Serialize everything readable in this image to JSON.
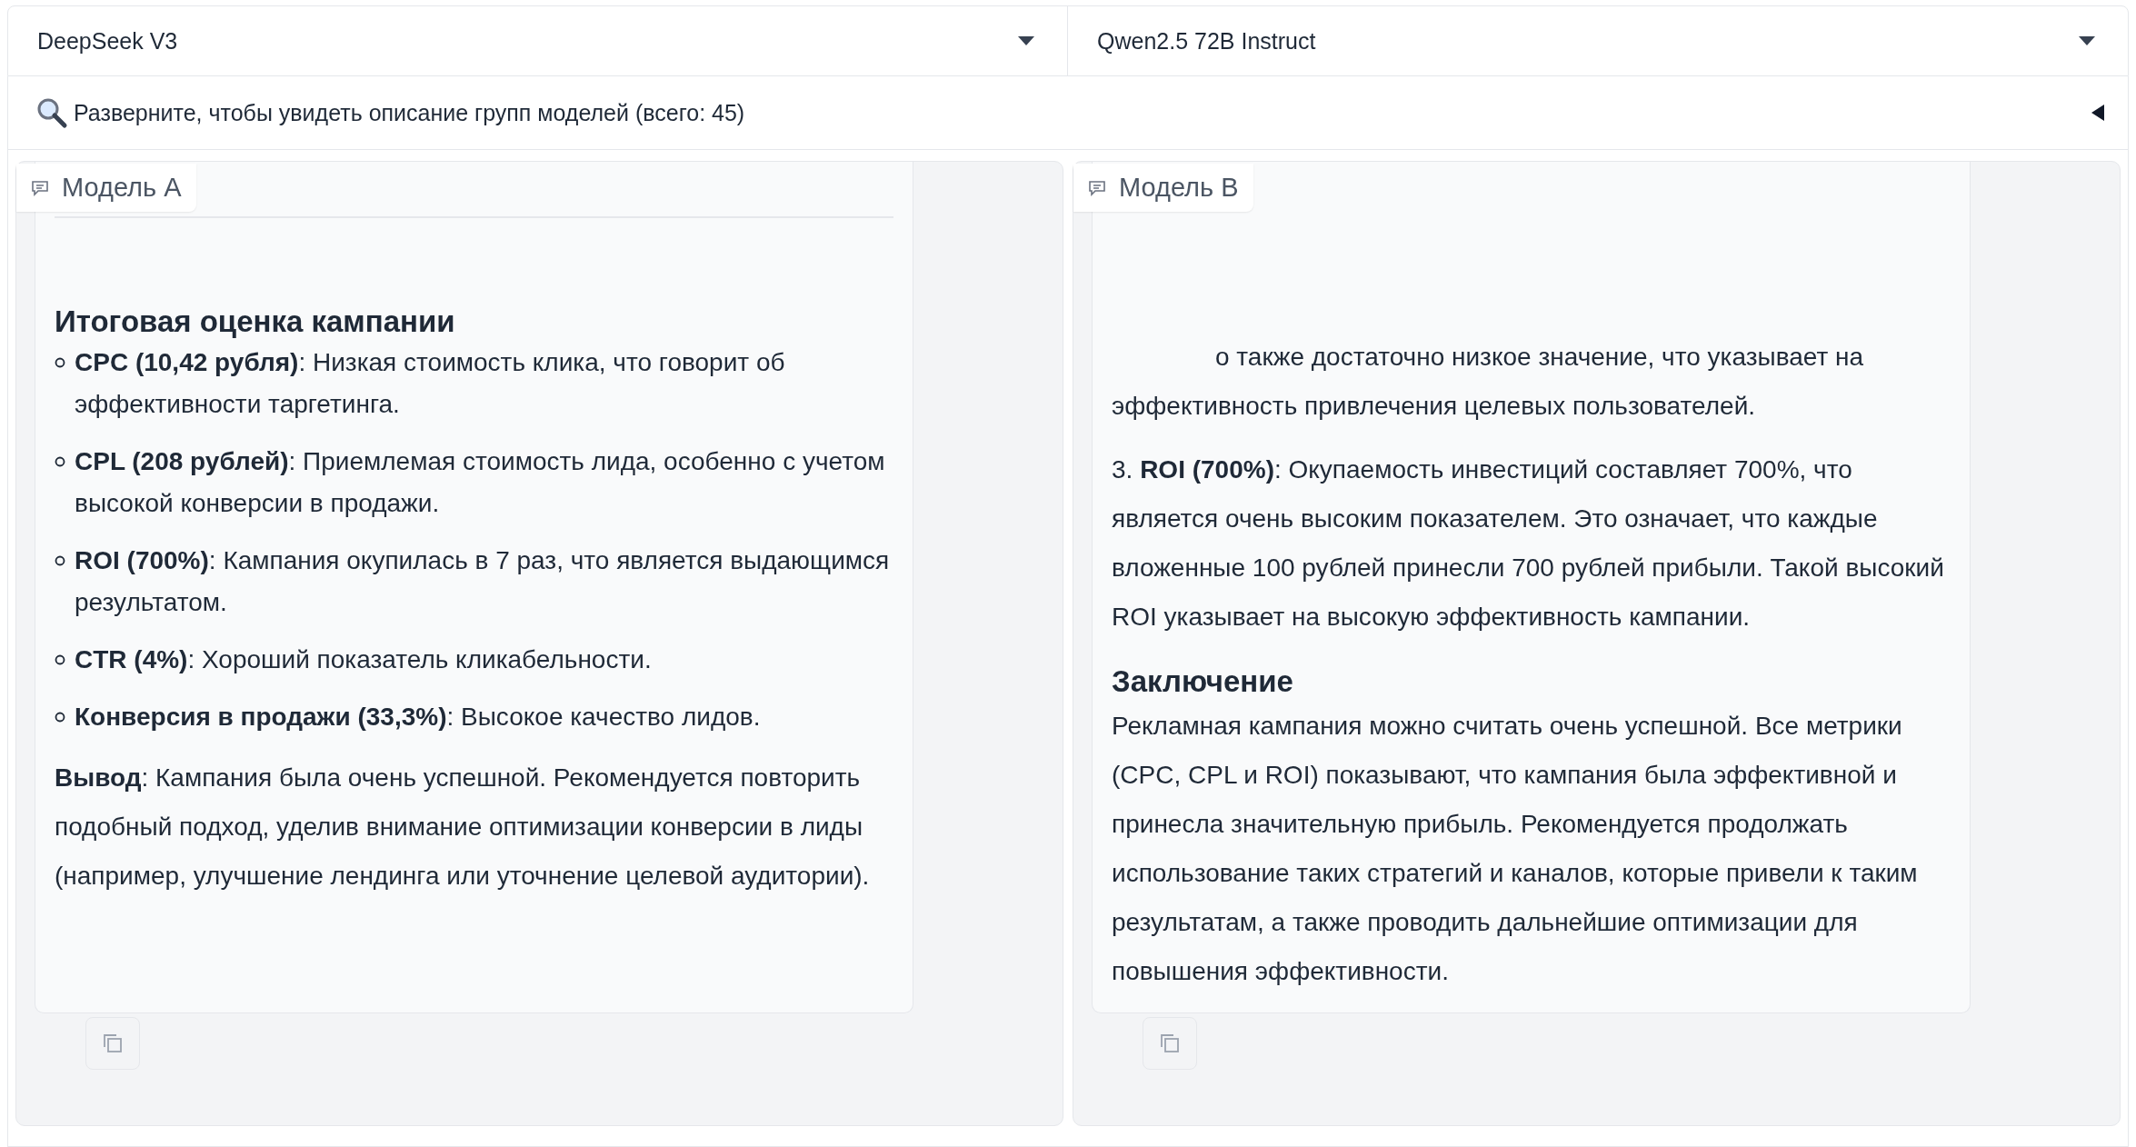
{
  "model_selectors": [
    {
      "value": "DeepSeek V3"
    },
    {
      "value": "Qwen2.5 72B Instruct"
    }
  ],
  "accordion": {
    "label": "Разверните, чтобы увидеть описание групп моделей (всего: 45)",
    "expanded": false
  },
  "panels": [
    {
      "label": "Модель A",
      "blocks": [
        {
          "kind": "rule"
        },
        {
          "kind": "heading",
          "text": "Итоговая оценка кампании"
        },
        {
          "kind": "bullet",
          "text": "**CPC (10,42 рубля)**: Низкая стоимость клика, что говорит об эффективности таргетинга."
        },
        {
          "kind": "bullet",
          "text": "**CPL (208 рублей)**: Приемлемая стоимость лида, особенно с учетом высокой конверсии в продажи."
        },
        {
          "kind": "bullet",
          "text": "**ROI (700%)**: Кампания окупилась в 7 раз, что является выдающимся результатом."
        },
        {
          "kind": "bullet",
          "text": "**CTR (4%)**: Хороший показатель кликабельности."
        },
        {
          "kind": "bullet",
          "text": "**Конверсия в продажи (33,3%)**: Высокое качество лидов."
        },
        {
          "kind": "paragraph",
          "text": "**Вывод**: Кампания была очень успешной. Рекомендуется повторить подобный подход, уделив внимание оптимизации конверсии в лиды (например, улучшение лендинга или уточнение целевой аудитории)."
        }
      ]
    },
    {
      "label": "Модель B",
      "blocks": [
        {
          "kind": "fragment",
          "text": "о также достаточно низкое значение, что указывает на эффективность привлечения целевых пользователей."
        },
        {
          "kind": "paragraph",
          "text": "3. **ROI (700%)**: Окупаемость инвестиций составляет 700%, что является очень высоким показателем. Это означает, что каждые вложенные 100 рублей принесли 700 рублей прибыли. Такой высокий ROI указывает на высокую эффективность кампании."
        },
        {
          "kind": "heading",
          "text": "Заключение"
        },
        {
          "kind": "paragraph",
          "text": "Рекламная кампания можно считать очень успешной. Все метрики (CPC, CPL и ROI) показывают, что кампания была эффективной и принесла значительную прибыль. Рекомендуется продолжать использование таких стратегий и каналов, которые привели к таким результатам, а также проводить дальнейшие оптимизации для повышения эффективности."
        }
      ]
    }
  ]
}
